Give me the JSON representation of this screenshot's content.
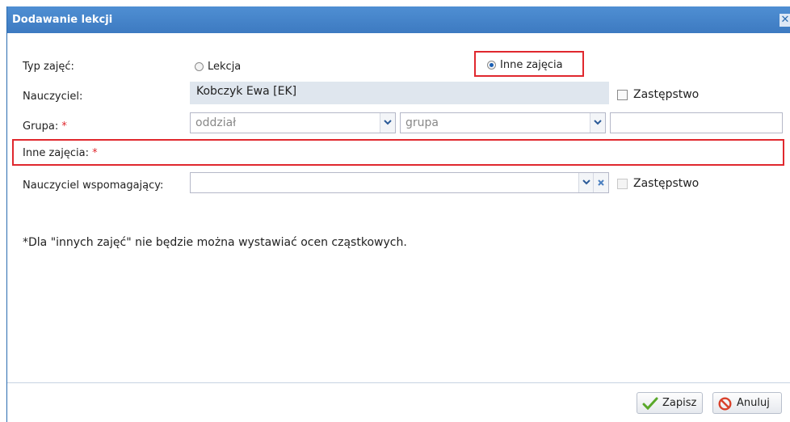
{
  "dialog": {
    "title": "Dodawanie lekcji",
    "close_glyph": "✕"
  },
  "form": {
    "type": {
      "label": "Typ zajęć:",
      "option_lesson": "Lekcja",
      "option_other": "Inne zajęcia",
      "selected": "Inne zajęcia"
    },
    "teacher": {
      "label": "Nauczyciel:",
      "value": "Kobczyk Ewa [EK]",
      "substitution_label": "Zastępstwo",
      "substitution_checked": false
    },
    "group": {
      "label": "Grupa:",
      "required_mark": "*",
      "class_placeholder": "oddział",
      "group_placeholder": "grupa",
      "extra_value": ""
    },
    "other_activity": {
      "label": "Inne zajęcia:",
      "required_mark": "*",
      "value": ""
    },
    "assistant_teacher": {
      "label": "Nauczyciel wspomagający:",
      "value": "",
      "substitution_label": "Zastępstwo",
      "substitution_checked": false
    }
  },
  "note": "*Dla \"innych zajęć\" nie będzie można wystawiać ocen cząstkowych.",
  "footer": {
    "save_label": "Zapisz",
    "cancel_label": "Anuluj"
  },
  "colors": {
    "titlebar": "#3d7ac1",
    "required": "#e0282e",
    "highlight": "#e0282e",
    "save_icon": "#5aa82a",
    "cancel_icon": "#d9412b"
  },
  "icons": {
    "close": "close-icon",
    "dropdown": "chevron-down-icon",
    "clear": "clear-icon",
    "save": "checkmark-icon",
    "cancel": "forbidden-icon"
  }
}
